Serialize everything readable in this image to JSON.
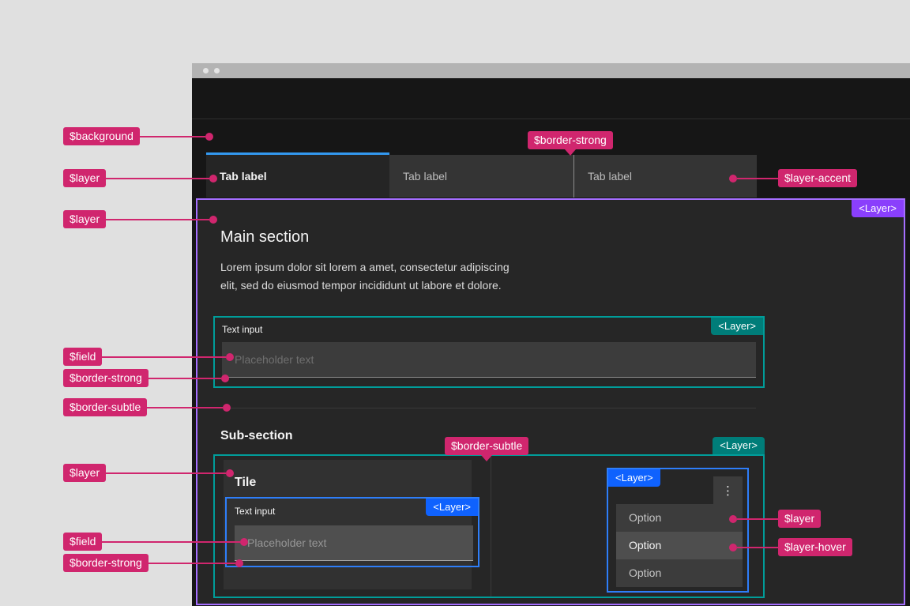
{
  "layer_badge": "<Layer>",
  "tabs": [
    {
      "label": "Tab label",
      "active": true
    },
    {
      "label": "Tab label",
      "active": false
    },
    {
      "label": "Tab label",
      "active": false
    }
  ],
  "main": {
    "heading": "Main section",
    "body_line1": "Lorem ipsum dolor sit lorem a amet, consectetur adipiscing",
    "body_line2": "elit, sed do eiusmod tempor incididunt ut labore et dolore.",
    "text_input": {
      "label": "Text input",
      "placeholder": "Placeholder text"
    }
  },
  "subsection": {
    "heading": "Sub-section",
    "tile": {
      "heading": "Tile",
      "text_input": {
        "label": "Text input",
        "placeholder": "Placeholder text"
      }
    },
    "menu": {
      "overflow_icon": "⋮",
      "options": [
        "Option",
        "Option",
        "Option"
      ],
      "hovered_index": 1
    }
  },
  "annotations": {
    "background": "$background",
    "layer": "$layer",
    "field": "$field",
    "border_strong": "$border-strong",
    "border_subtle": "$border-subtle",
    "layer_accent": "$layer-accent",
    "layer_hover": "$layer-hover"
  },
  "colors": {
    "page_background": "#e0e0e0",
    "app_background": "#161616",
    "layer": "#262626",
    "layer_accent": "#343434",
    "layer_hover": "#4e4e4e",
    "field": "#3c3c3c",
    "field_02": "#4f4f4f",
    "border_strong": "#8d8d8d",
    "border_subtle": "#3a3a3a",
    "annotation_pink": "#d0266e",
    "badge_purple": "#8a3ffc",
    "badge_teal": "#007d79",
    "badge_blue": "#0f62fe",
    "outline_purple": "#a56eff",
    "outline_teal": "#009d9a",
    "outline_blue": "#2e7ef9",
    "tab_underline": "#3398ef",
    "titlebar": "#b3b3b3"
  }
}
